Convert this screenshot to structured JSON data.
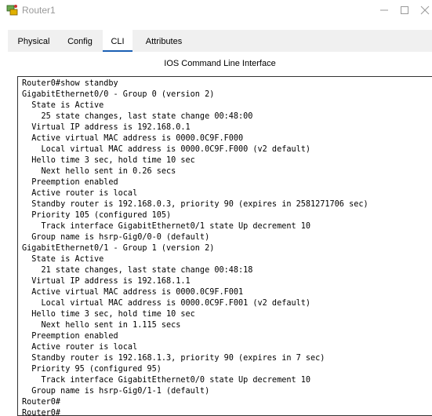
{
  "window": {
    "title": "Router1",
    "icon": "router-icon"
  },
  "tabs": [
    {
      "label": "Physical"
    },
    {
      "label": "Config"
    },
    {
      "label": "CLI",
      "active": true
    },
    {
      "label": "Attributes"
    }
  ],
  "panel": {
    "heading": "IOS Command Line Interface"
  },
  "terminal": {
    "lines": [
      "Router0#show standby",
      "GigabitEthernet0/0 - Group 0 (version 2)",
      "  State is Active",
      "    25 state changes, last state change 00:48:00",
      "  Virtual IP address is 192.168.0.1",
      "  Active virtual MAC address is 0000.0C9F.F000",
      "    Local virtual MAC address is 0000.0C9F.F000 (v2 default)",
      "  Hello time 3 sec, hold time 10 sec",
      "    Next hello sent in 0.26 secs",
      "  Preemption enabled",
      "  Active router is local",
      "  Standby router is 192.168.0.3, priority 90 (expires in 2581271706 sec)",
      "  Priority 105 (configured 105)",
      "    Track interface GigabitEthernet0/1 state Up decrement 10",
      "  Group name is hsrp-Gig0/0-0 (default)",
      "GigabitEthernet0/1 - Group 1 (version 2)",
      "  State is Active",
      "    21 state changes, last state change 00:48:18",
      "  Virtual IP address is 192.168.1.1",
      "  Active virtual MAC address is 0000.0C9F.F001",
      "    Local virtual MAC address is 0000.0C9F.F001 (v2 default)",
      "  Hello time 3 sec, hold time 10 sec",
      "    Next hello sent in 1.115 secs",
      "  Preemption enabled",
      "  Active router is local",
      "  Standby router is 192.168.1.3, priority 90 (expires in 7 sec)",
      "  Priority 95 (configured 95)",
      "    Track interface GigabitEthernet0/0 state Up decrement 10",
      "  Group name is hsrp-Gig0/1-1 (default)",
      "Router0#",
      "Router0#"
    ]
  }
}
